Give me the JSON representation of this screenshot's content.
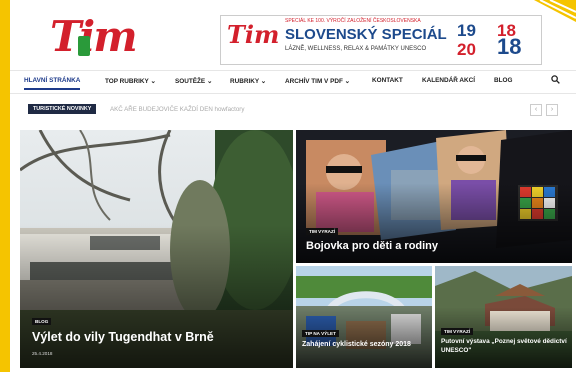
{
  "header": {
    "logo_text": "Tim",
    "banner": {
      "small": "SPECIÁL KE 100. VÝROČÍ ZALOŽENÍ ČESKOSLOVENSKA",
      "logo": "Tim",
      "title": "SLOVENSKÝ SPECIÁL",
      "subtitle": "LÁZNĚ, WELLNESS, RELAX & PAMÁTKY UNESCO",
      "year_top_left": "19",
      "year_top_right": "18",
      "year_bottom_left": "20",
      "year_bottom_right": "18"
    }
  },
  "nav": {
    "items": [
      {
        "label": "HLAVNÍ STRÁNKA"
      },
      {
        "label": "TOP RUBRIKY ⌄"
      },
      {
        "label": "SOUTĚŽE ⌄"
      },
      {
        "label": "RUBRIKY ⌄"
      },
      {
        "label": "ARCHÍV TIM V PDF ⌄"
      },
      {
        "label": "KONTAKT"
      },
      {
        "label": "KALENDÁŘ AKCÍ"
      },
      {
        "label": "BLOG"
      }
    ]
  },
  "ticker": {
    "tag": "TURISTICKÉ NOVINKY",
    "text": "AKČ AŘE BUDEJOVIČE KAŽDÍ DEN howfactory",
    "prev": "‹",
    "next": "›"
  },
  "tiles": [
    {
      "badge": "BLOG",
      "title": "Výlet do vily Tugendhat v Brně",
      "date": "25.4.2018"
    },
    {
      "badge": "TIM VYRAZÍ",
      "title": "Bojovka pro děti a rodiny"
    },
    {
      "badge": "TIP NA VÝLET",
      "title": "Zahájení cyklistické sezóny 2018"
    },
    {
      "badge": "TIM VYRAZÍ",
      "title": "Putovní výstava „Poznej světové dědictví UNESCO\""
    }
  ],
  "colors": {
    "frame": "#f5c400",
    "brand_red": "#d3202c",
    "nav_active": "#1d3a8a",
    "ticker_tag": "#1f2a44"
  }
}
